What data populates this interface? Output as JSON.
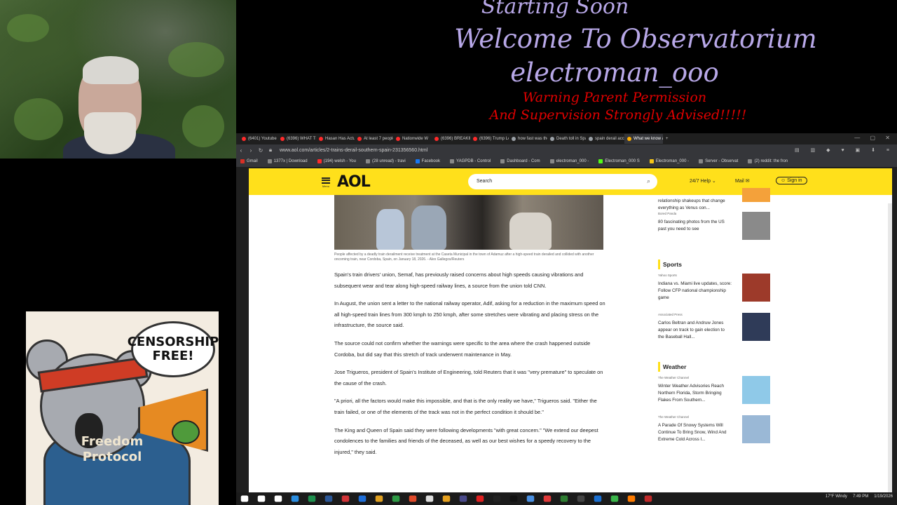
{
  "overlay": {
    "line1": "Starting Soon",
    "line2": "Welcome To Observatorium",
    "line3": "electroman_ooo",
    "warning1": "Warning Parent Permission",
    "warning2": "And Supervision Strongly Advised!!!!!"
  },
  "sticker": {
    "bubble": "CENSORSHIP FREE!",
    "hoodie": "Freedom Protocol"
  },
  "browser": {
    "tabs": [
      {
        "label": "(6401) Youtube",
        "color": "#ff2a2a"
      },
      {
        "label": "(6396) WHAT TH",
        "color": "#ff2a2a"
      },
      {
        "label": "Hasan Has Actual",
        "color": "#ff2a2a"
      },
      {
        "label": "At least 7 people",
        "color": "#ff2a2a"
      },
      {
        "label": "Nationwide W",
        "color": "#ff2a2a"
      },
      {
        "label": "(6396) BREAKING",
        "color": "#ff2a2a"
      },
      {
        "label": "(6396) Trump Le",
        "color": "#ff2a2a"
      },
      {
        "label": "how fast was the",
        "color": "#9aa0a6"
      },
      {
        "label": "Death toll in Spa",
        "color": "#9aa0a6"
      },
      {
        "label": "spain derail acc",
        "color": "#9aa0a6"
      },
      {
        "label": "What we know about the",
        "color": "#ffb000"
      }
    ],
    "new_tab": "+",
    "url": "www.aol.com/articles/2-trains-derail-southern-spain-231356560.html",
    "bookmarks": [
      {
        "label": "Gmail",
        "color": "#d93025"
      },
      {
        "label": "1377x | Download",
        "color": "#888"
      },
      {
        "label": "(194) welsh - You",
        "color": "#ff2a2a"
      },
      {
        "label": "(28 unread) - travi",
        "color": "#888"
      },
      {
        "label": "Facebook",
        "color": "#1877f2"
      },
      {
        "label": "YAGPDB - Control",
        "color": "#888"
      },
      {
        "label": "Dashboard - Com",
        "color": "#888"
      },
      {
        "label": "electroman_000 -",
        "color": "#888"
      },
      {
        "label": "Electroman_000 S",
        "color": "#53fc18"
      },
      {
        "label": "Electroman_000 -",
        "color": "#f5c518"
      },
      {
        "label": "Server - Observat",
        "color": "#888"
      },
      {
        "label": "(2) reddit: the fron",
        "color": "#888"
      }
    ]
  },
  "aol": {
    "menu_label": "Menu",
    "logo": "AOL",
    "search_placeholder": "Search",
    "help": "24/7 Help",
    "mail": "Mail",
    "signin": "Sign in"
  },
  "article": {
    "caption": "People affected by a deadly train derailment receive treatment at the Caseta Municipal in the town of Adamuz after a high-speed train derailed and collided with another oncoming train, near Cordoba, Spain, on January 18, 2026. - Alex Gallegos/Reuters",
    "paragraphs": [
      "Spain's train drivers' union, Semaf, has previously raised concerns about high speeds causing vibrations and subsequent wear and tear along high-speed railway lines, a source from the union told CNN.",
      "In August, the union sent a letter to the national railway operator, Adif, asking for a reduction in the maximum speed on all high-speed train lines from 300 kmph to 250 kmph, after some stretches were vibrating and placing stress on the infrastructure, the source said.",
      "The source could not confirm whether the warnings were specific to the area where the crash happened outside Cordoba, but did say that this stretch of track underwent maintenance in May.",
      "Jose Trigueros, president of Spain's Institute of Engineering, told Reuters that it was \"very premature\" to speculate on the cause of the crash.",
      "\"A priori, all the factors would make this impossible, and that is the only reality we have,\" Trigueros said. \"Either the train failed, or one of the elements of the track was not in the perfect condition it should be.\"",
      "The King and Queen of Spain said they were following developments \"with great concern.\" \"We extend our deepest condolences to the families and friends of the deceased, as well as our best wishes for a speedy recovery to the injured,\" they said."
    ]
  },
  "sidebar": {
    "top_cards": [
      {
        "source": "",
        "title": "relationship shakeups that change everything as Venus con...",
        "thumb": "#f4a13a"
      },
      {
        "source": "Bored Panda",
        "title": "80 fascinating photos from the US past you need to see",
        "thumb": "#8a8a8a"
      }
    ],
    "sports_heading": "Sports",
    "sports": [
      {
        "source": "Yahoo Sports",
        "title": "Indiana vs. Miami live updates, score: Follow CFP national championship game",
        "thumb": "#9d3a2a"
      },
      {
        "source": "Associated Press",
        "title": "Carlos Beltran and Andruw Jones appear on track to gain election to the Baseball Hall...",
        "thumb": "#2f3b58"
      }
    ],
    "weather_heading": "Weather",
    "weather": [
      {
        "source": "The Weather Channel",
        "title": "Winter Weather Advisories Reach Northern Florida, Storm Bringing Flakes From Southern...",
        "thumb": "#8fc9e8"
      },
      {
        "source": "The Weather Channel",
        "title": "A Parade Of Snowy Systems Will Continue To Bring Snow, Wind And Extreme Cold Across I...",
        "thumb": "#9ab8d6"
      }
    ]
  },
  "taskbar": {
    "weather": "17°F Windy",
    "time": "7:49 PM",
    "date": "1/19/2026",
    "icon_colors": [
      "#fff",
      "#fff",
      "#fff",
      "#2a8de0",
      "#1e8f4e",
      "#2b5797",
      "#d13438",
      "#1e6ed8",
      "#e0a020",
      "#2e9a45",
      "#e04a2a",
      "#ddd",
      "#e6a11f",
      "#4a4a8a",
      "#e02020",
      "#222",
      "#111",
      "#4a90e2",
      "#e03a3a",
      "#2e7d32",
      "#444",
      "#1a6fd0",
      "#3ab54a",
      "#ff7b00",
      "#c02a2a"
    ]
  }
}
